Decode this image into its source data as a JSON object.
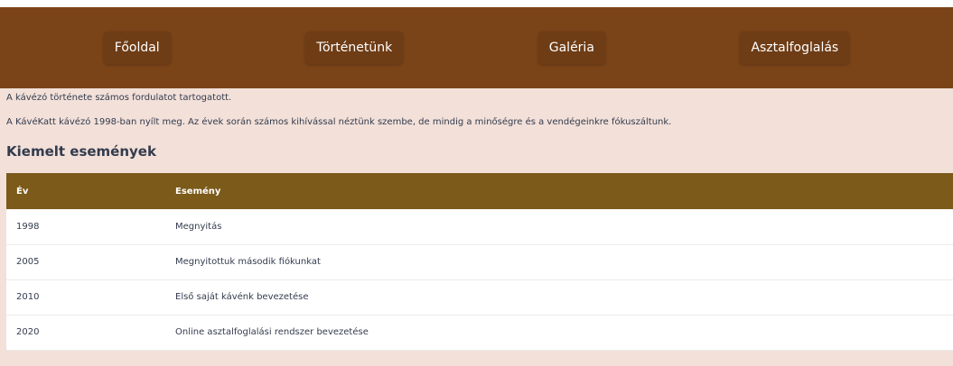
{
  "nav": {
    "items": [
      {
        "label": "Főoldal"
      },
      {
        "label": "Történetünk"
      },
      {
        "label": "Galéria"
      },
      {
        "label": "Asztalfoglalás"
      }
    ]
  },
  "content": {
    "intro": "A kávézó története számos fordulatot tartogatott.",
    "paragraph": "A KávéKatt kávézó 1998-ban nyílt meg. Az évek során számos kihívással néztünk szembe, de mindig a minőségre és a vendégeinkre fókuszáltunk.",
    "section_title": "Kiemelt események"
  },
  "table": {
    "headers": [
      "Év",
      "Esemény"
    ],
    "rows": [
      {
        "year": "1998",
        "event": "Megnyitás"
      },
      {
        "year": "2005",
        "event": "Megnyitottuk második fiókunkat"
      },
      {
        "year": "2010",
        "event": "Első saját kávénk bevezetése"
      },
      {
        "year": "2020",
        "event": "Online asztalfoglalási rendszer bevezetése"
      }
    ]
  },
  "colors": {
    "navbar": "#7b4418",
    "nav_button": "#6e3c15",
    "page_background": "#f2e0d9",
    "table_header": "#7b5a1a",
    "text": "#333b4d"
  }
}
